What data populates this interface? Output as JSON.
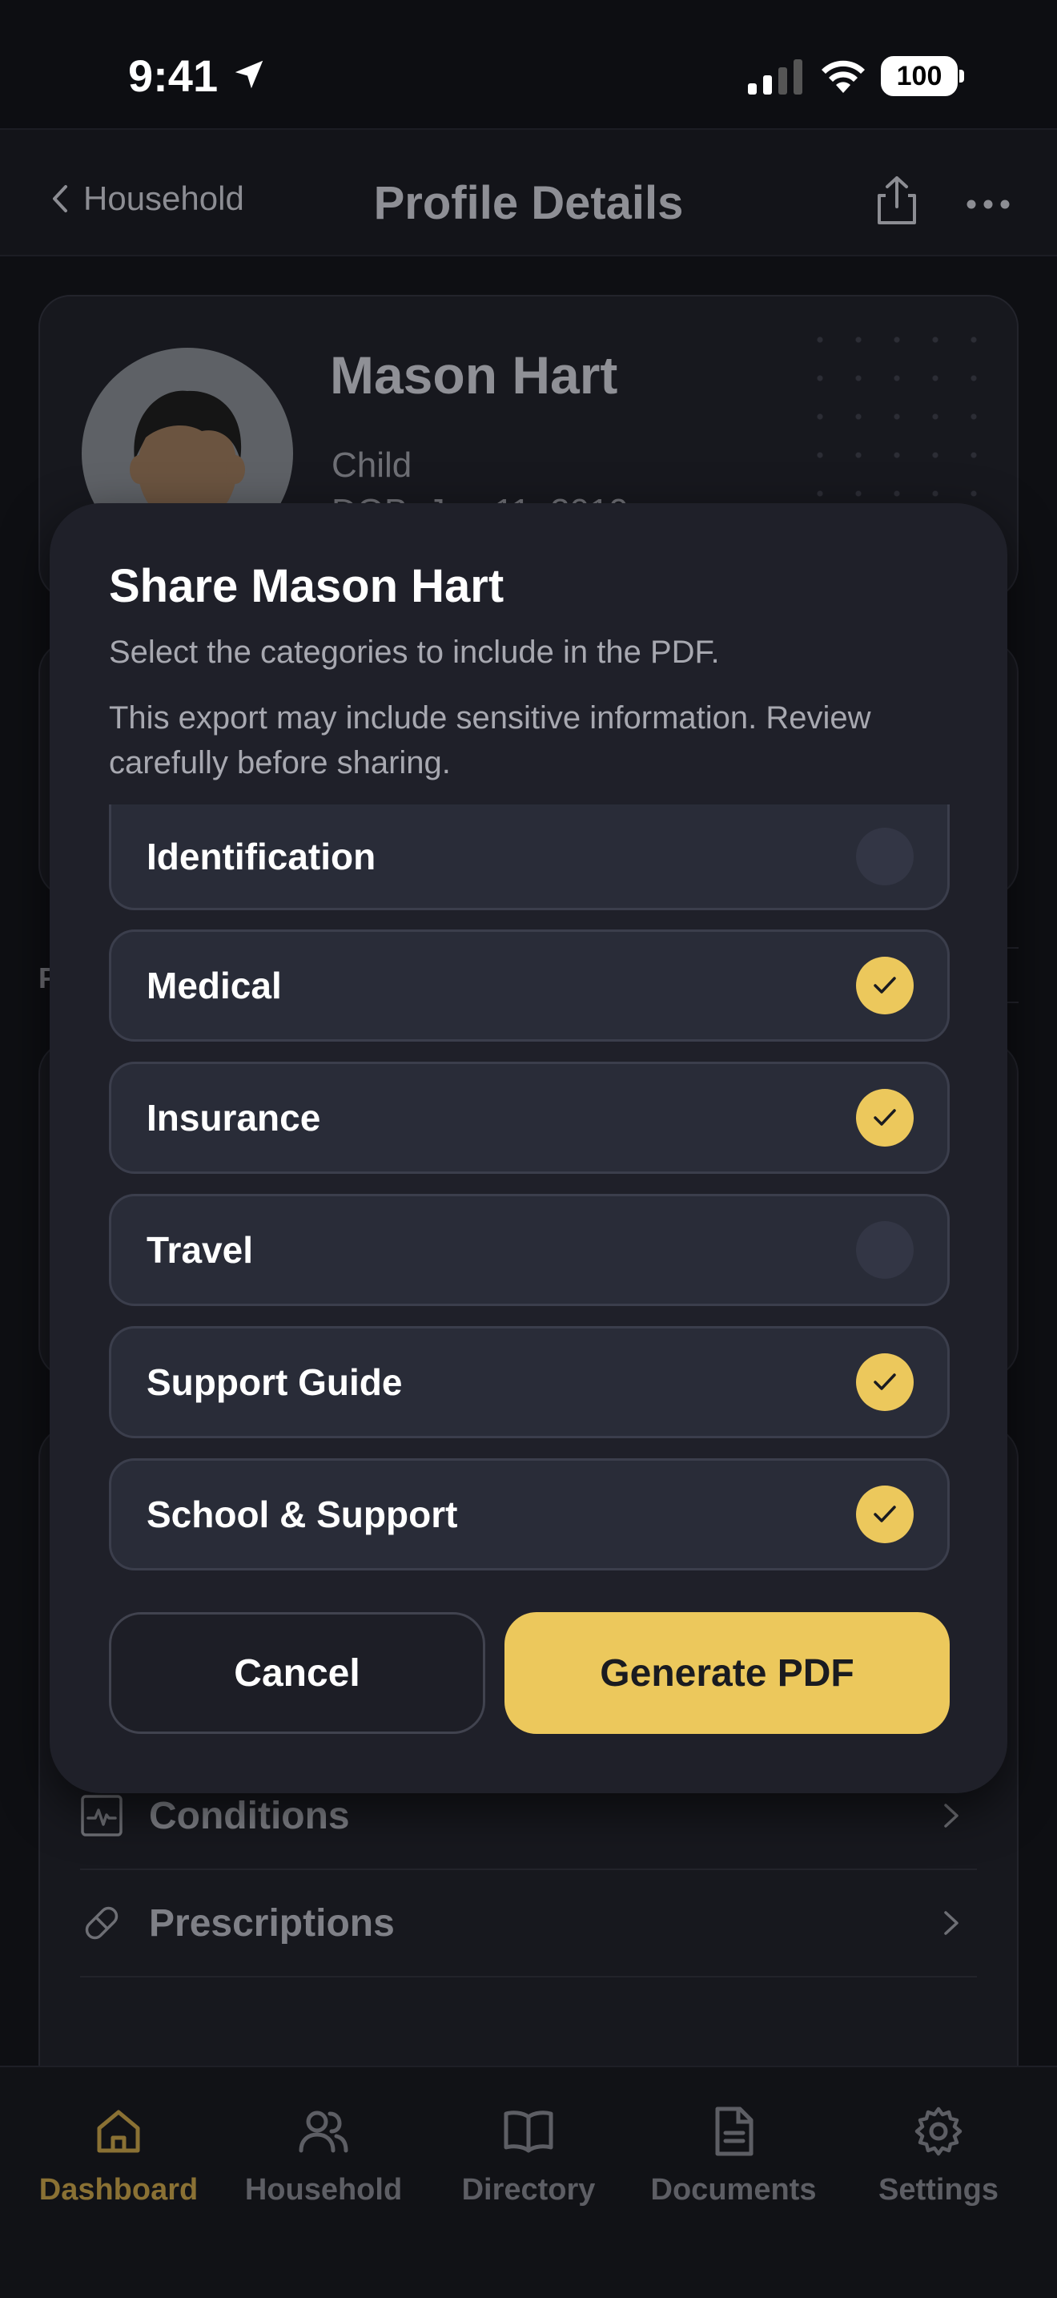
{
  "status_bar": {
    "time": "9:41",
    "battery": "100"
  },
  "nav": {
    "back_label": "Household",
    "title": "Profile Details"
  },
  "profile": {
    "name": "Mason Hart",
    "role": "Child",
    "dob": "DOB: Jan 11, 2019"
  },
  "background": {
    "section_letter": "F"
  },
  "background_rows": [
    {
      "label": "Conditions"
    },
    {
      "label": "Prescriptions"
    }
  ],
  "modal": {
    "title": "Share Mason Hart",
    "subtitle": "Select the categories to include in the PDF.",
    "warning": "This export may include sensitive information. Review carefully before sharing.",
    "cancel_label": "Cancel",
    "generate_label": "Generate PDF",
    "options": [
      {
        "label": "Identification",
        "checked": false
      },
      {
        "label": "Medical",
        "checked": true
      },
      {
        "label": "Insurance",
        "checked": true
      },
      {
        "label": "Travel",
        "checked": false
      },
      {
        "label": "Support Guide",
        "checked": true
      },
      {
        "label": "School & Support",
        "checked": true
      }
    ]
  },
  "tabs": [
    {
      "label": "Dashboard",
      "icon": "home-icon",
      "active": true
    },
    {
      "label": "Household",
      "icon": "users-icon",
      "active": false
    },
    {
      "label": "Directory",
      "icon": "book-icon",
      "active": false
    },
    {
      "label": "Documents",
      "icon": "document-icon",
      "active": false
    },
    {
      "label": "Settings",
      "icon": "gear-icon",
      "active": false
    }
  ],
  "colors": {
    "accent": "#ecc85c",
    "modal_bg": "#1f2029",
    "option_bg": "#292c38"
  }
}
